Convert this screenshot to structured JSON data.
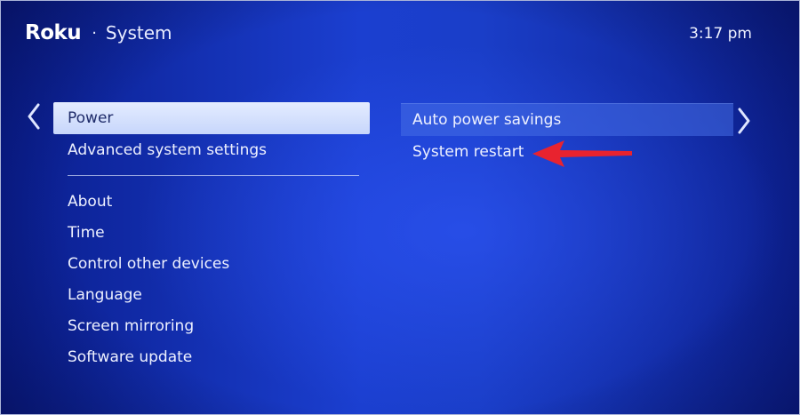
{
  "header": {
    "logo": "Roku",
    "separator": "·",
    "section": "System"
  },
  "clock": "3:17 pm",
  "left_menu": {
    "selected": "Power",
    "items_top": [
      "Advanced system settings"
    ],
    "items": [
      "About",
      "Time",
      "Control other devices",
      "Language",
      "Screen mirroring",
      "Software update"
    ]
  },
  "right_menu": {
    "items": [
      "Auto power savings",
      "System restart"
    ]
  },
  "colors": {
    "accent_arrow": "#e8232f",
    "background": "#1a3ec8"
  },
  "icons": {
    "left": "chevron-left-icon",
    "right": "chevron-right-icon",
    "annotation": "red-arrow-icon"
  }
}
